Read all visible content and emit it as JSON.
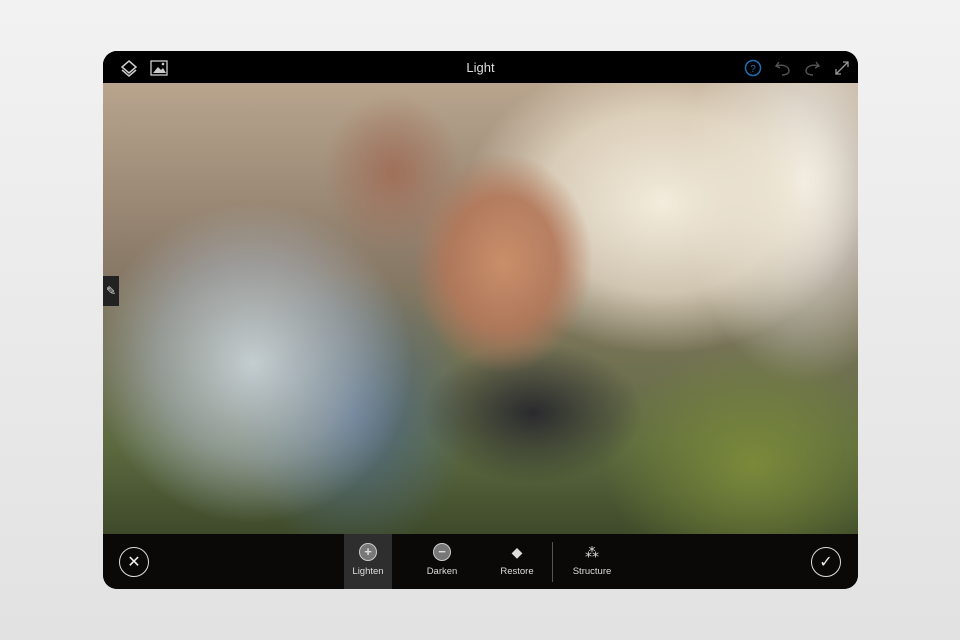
{
  "header": {
    "title": "Light",
    "icons": [
      "layers-icon",
      "image-icon",
      "help-icon",
      "undo-icon",
      "redo-icon",
      "fullscreen-icon"
    ]
  },
  "toolbar": {
    "cancel_icon": "close-icon",
    "confirm_icon": "check-icon",
    "tools": [
      {
        "label": "Lighten",
        "icon": "lighten-icon",
        "active": true
      },
      {
        "label": "Darken",
        "icon": "darken-icon"
      },
      {
        "label": "Restore",
        "icon": "eraser-icon"
      },
      {
        "label": "Structure",
        "icon": "magic-wand-icon"
      }
    ]
  },
  "colors": {
    "accent": "#1f6fb5",
    "bar": "#000000"
  }
}
